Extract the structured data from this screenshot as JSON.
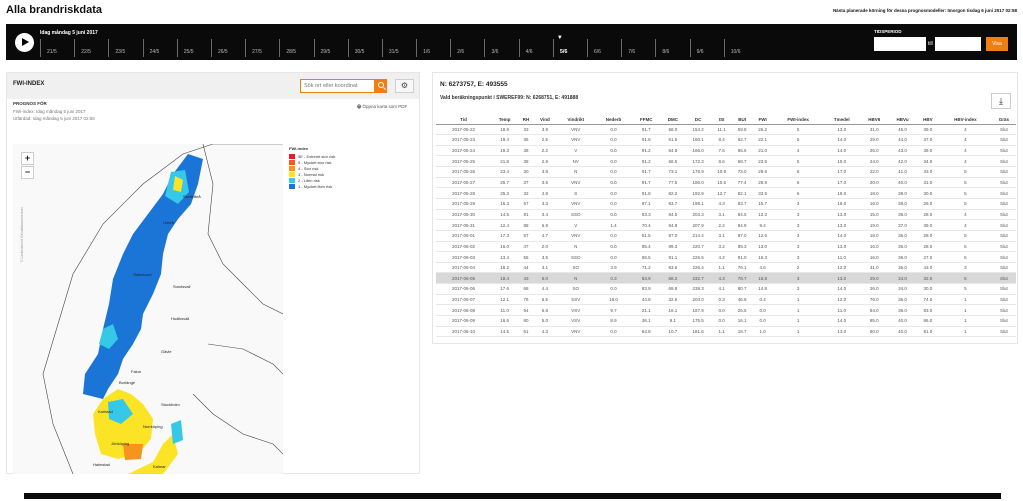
{
  "page_title": "Alla brandriskdata",
  "next_run": "Nästa planerade körning för dessa prognosmodeller: Imorgon tisdag 6 juni 2017 02:58",
  "timeline": {
    "today_label": "Idag måndag 5 juni 2017",
    "dates": [
      "21/5",
      "22/5",
      "23/5",
      "24/5",
      "25/5",
      "26/5",
      "27/5",
      "28/5",
      "29/5",
      "30/5",
      "31/5",
      "1/6",
      "2/6",
      "3/6",
      "4/6",
      "5/6",
      "6/6",
      "7/6",
      "8/6",
      "9/6",
      "10/6"
    ],
    "current_date": "5/6",
    "period_label": "TIDSPERIOD",
    "period_sep": "till",
    "period_button": "Visa"
  },
  "left_panel": {
    "title": "FWI-INDEX",
    "search_placeholder": "Sök ort eller koordinat",
    "prognos_title": "PROGNOS FÖR",
    "prognos_lines": [
      "FWI-index: Idag måndag 5 juni 2017",
      "Utfärdad: Idag måndag 5 juni 2017 02:58"
    ],
    "pdf_link": "Öppna karta som PDF",
    "zoom_in": "+",
    "zoom_out": "−",
    "attribution": "© Lantmäteriet Geodatasamverkan",
    "map_labels": [
      "Umeå",
      "Skellefteå",
      "Östersund",
      "Sundsvall",
      "Hudiksvall",
      "Gävle",
      "Falun",
      "Karlstad",
      "Stockholm",
      "Norrköping",
      "Jönköping",
      "Halmstad",
      "Kalmar",
      "Borlänge"
    ]
  },
  "legend": {
    "title": "FWI-index",
    "items": [
      {
        "label": "5E - Extremt stor risk",
        "color": "#e0201b"
      },
      {
        "label": "5 - Mycket stor risk",
        "color": "#f15a24"
      },
      {
        "label": "4 - Stor risk",
        "color": "#f7941d"
      },
      {
        "label": "3 - Normal risk",
        "color": "#fbe426"
      },
      {
        "label": "2 - Liten risk",
        "color": "#36c8e8"
      },
      {
        "label": "1 - Mycket liten risk",
        "color": "#1b75d6"
      }
    ]
  },
  "right_panel": {
    "coords": "N: 6273757, E: 493555",
    "calc_point": "Vald beräkningspunkt i SWEREF99: N: 6268751, E: 491888",
    "download_icon": "download-icon"
  },
  "table": {
    "headers": [
      "Tid",
      "Temp",
      "RH",
      "Vind",
      "Vindrikt",
      "Nederb",
      "FFMC",
      "DMC",
      "DC",
      "ISI",
      "BUI",
      "FWI",
      "FWI-index",
      "Tmedel",
      "HBV6",
      "HBVu",
      "HBV",
      "HBV-index",
      "Gräs"
    ],
    "rows": [
      [
        "2017-05-22",
        "18.9",
        "33",
        "3.9",
        "VNV",
        "0.0",
        "91.7",
        "58.0",
        "154.2",
        "11.1",
        "59.8",
        "26.2",
        "5",
        "13.0",
        "31.0",
        "45.0",
        "39.0",
        "4",
        "Slut"
      ],
      [
        "2017-05-23",
        "19.4",
        "35",
        "2.5",
        "VNV",
        "0.0",
        "91.6",
        "61.5",
        "160.1",
        "8.4",
        "62.7",
        "22.1",
        "5",
        "14.0",
        "29.0",
        "44.0",
        "37.0",
        "4",
        "Slut"
      ],
      [
        "2017-05-24",
        "19.3",
        "38",
        "2.2",
        "V",
        "0.0",
        "91.2",
        "64.8",
        "166.0",
        "7.6",
        "65.6",
        "21.0",
        "4",
        "14.0",
        "26.0",
        "43.0",
        "36.0",
        "4",
        "Slut"
      ],
      [
        "2017-05-25",
        "21.8",
        "38",
        "2.9",
        "NV",
        "0.0",
        "91.2",
        "68.5",
        "172.3",
        "8.6",
        "68.7",
        "23.5",
        "5",
        "15.0",
        "24.0",
        "42.0",
        "34.0",
        "4",
        "Slut"
      ],
      [
        "2017-05-26",
        "23.4",
        "30",
        "3.8",
        "N",
        "0.0",
        "91.7",
        "73.1",
        "178.9",
        "10.9",
        "73.0",
        "28.6",
        "6",
        "17.0",
        "22.0",
        "41.0",
        "33.0",
        "5",
        "Slut"
      ],
      [
        "2017-05-27",
        "25.7",
        "37",
        "3.6",
        "VNV",
        "0.0",
        "91.7",
        "77.5",
        "186.0",
        "10.6",
        "77.4",
        "28.9",
        "6",
        "17.0",
        "20.0",
        "40.0",
        "31.0",
        "5",
        "Slut"
      ],
      [
        "2017-05-28",
        "25.3",
        "32",
        "4.8",
        "S",
        "0.0",
        "91.8",
        "82.2",
        "192.9",
        "12.7",
        "82.1",
        "33.5",
        "6",
        "18.0",
        "18.0",
        "39.0",
        "30.0",
        "5",
        "Slut"
      ],
      [
        "2017-05-29",
        "16.3",
        "67",
        "3.3",
        "VNV",
        "0.0",
        "87.1",
        "83.7",
        "198.1",
        "4.3",
        "83.7",
        "15.7",
        "3",
        "16.0",
        "16.0",
        "38.0",
        "29.0",
        "5",
        "Slut"
      ],
      [
        "2017-05-30",
        "14.5",
        "81",
        "3.4",
        "SSO",
        "0.0",
        "83.3",
        "84.5",
        "203.3",
        "3.1",
        "84.5",
        "12.3",
        "3",
        "13.0",
        "15.0",
        "38.0",
        "28.0",
        "4",
        "Slut"
      ],
      [
        "2017-05-31",
        "12.4",
        "88",
        "6.9",
        "V",
        "1.4",
        "70.4",
        "84.9",
        "207.9",
        "2.2",
        "84.9",
        "9.4",
        "3",
        "13.0",
        "19.0",
        "37.0",
        "39.0",
        "4",
        "Slut"
      ],
      [
        "2017-06-01",
        "17.3",
        "57",
        "4.7",
        "VNV",
        "0.0",
        "81.5",
        "87.0",
        "214.4",
        "3.1",
        "87.0",
        "12.6",
        "3",
        "14.0",
        "18.0",
        "36.0",
        "28.0",
        "5",
        "Slut"
      ],
      [
        "2017-06-02",
        "16.0",
        "47",
        "2.0",
        "N",
        "0.0",
        "85.4",
        "89.3",
        "220.7",
        "3.2",
        "89.3",
        "13.0",
        "3",
        "13.0",
        "16.0",
        "36.0",
        "28.0",
        "6",
        "Slut"
      ],
      [
        "2017-06-03",
        "13.4",
        "55",
        "3.5",
        "SSO",
        "0.0",
        "85.5",
        "91.1",
        "226.5",
        "4.2",
        "91.0",
        "16.3",
        "3",
        "11.0",
        "16.0",
        "36.0",
        "27.0",
        "6",
        "Slut"
      ],
      [
        "2017-06-04",
        "18.2",
        "44",
        "3.1",
        "SO",
        "3.9",
        "71.2",
        "83.6",
        "226.4",
        "1.1",
        "76.1",
        "4.6",
        "2",
        "12.0",
        "31.0",
        "35.0",
        "43.0",
        "3",
        "Slut"
      ],
      [
        "2017-06-05",
        "18.4",
        "43",
        "5.0",
        "N",
        "0.3",
        "83.9",
        "68.2",
        "232.7",
        "4.3",
        "78.7",
        "15.8",
        "3",
        "13.0",
        "29.0",
        "34.0",
        "32.0",
        "5",
        "Slut"
      ],
      [
        "2017-06-06",
        "17.6",
        "68",
        "4.4",
        "SO",
        "0.0",
        "83.9",
        "69.8",
        "239.3",
        "4.1",
        "80.7",
        "14.8",
        "3",
        "14.0",
        "26.0",
        "34.0",
        "30.0",
        "5",
        "Slut"
      ],
      [
        "2017-06-07",
        "12.1",
        "76",
        "6.5",
        "SSV",
        "16.0",
        "44.8",
        "32.6",
        "204.0",
        "0.3",
        "46.6",
        "0.4",
        "1",
        "12.0",
        "76.0",
        "36.0",
        "74.0",
        "1",
        "Slut"
      ],
      [
        "2017-06-08",
        "11.0",
        "94",
        "6.8",
        "VSV",
        "9.7",
        "21.1",
        "16.1",
        "187.9",
        "0.0",
        "26.5",
        "0.0",
        "1",
        "11.0",
        "84.0",
        "38.0",
        "83.0",
        "1",
        "Slut"
      ],
      [
        "2017-06-09",
        "16.6",
        "80",
        "5.0",
        "VSV",
        "8.9",
        "36.1",
        "9.1",
        "175.5",
        "0.0",
        "16.1",
        "0.0",
        "1",
        "14.0",
        "85.0",
        "40.0",
        "86.0",
        "1",
        "Slut"
      ],
      [
        "2017-06-10",
        "14.5",
        "61",
        "4.3",
        "VNV",
        "0.0",
        "64.8",
        "10.7",
        "181.6",
        "1.1",
        "18.7",
        "1.0",
        "1",
        "13.0",
        "80.0",
        "40.0",
        "81.0",
        "1",
        "Slut"
      ]
    ],
    "highlight_date": "2017-06-05"
  }
}
